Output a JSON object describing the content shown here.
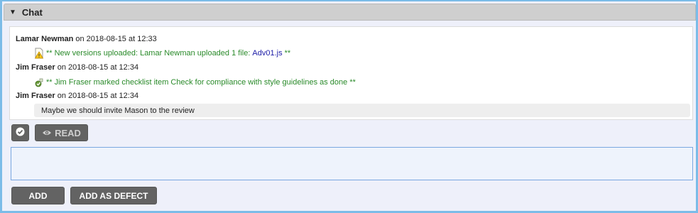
{
  "panel": {
    "title": "Chat",
    "toggle_glyph": "▼"
  },
  "messages": [
    {
      "author": "Lamar Newman",
      "meta": " on 2018-08-15 at 12:33",
      "system": {
        "icon": "warning-file-icon",
        "text_before": "** New versions uploaded: Lamar Newman uploaded 1 file:",
        "link": "Adv01.js",
        "text_after": "**"
      }
    },
    {
      "author": "Jim Fraser",
      "meta": " on 2018-08-15 at 12:34",
      "system": {
        "icon": "checklist-icon",
        "text": "** Jim Fraser marked checklist item Check for compliance with style guidelines as done **"
      }
    },
    {
      "author": "Jim Fraser",
      "meta": " on 2018-08-15 at 12:34",
      "comment": "Maybe we should invite Mason to the review"
    }
  ],
  "toolbar": {
    "read_label": "READ"
  },
  "composer": {
    "value": "",
    "placeholder": ""
  },
  "actions": {
    "add_label": "ADD",
    "add_defect_label": "ADD AS DEFECT"
  },
  "colors": {
    "frame_border": "#7bbce8",
    "system_text": "#2a8a2a",
    "link": "#1a1aa6",
    "button": "#636363"
  }
}
